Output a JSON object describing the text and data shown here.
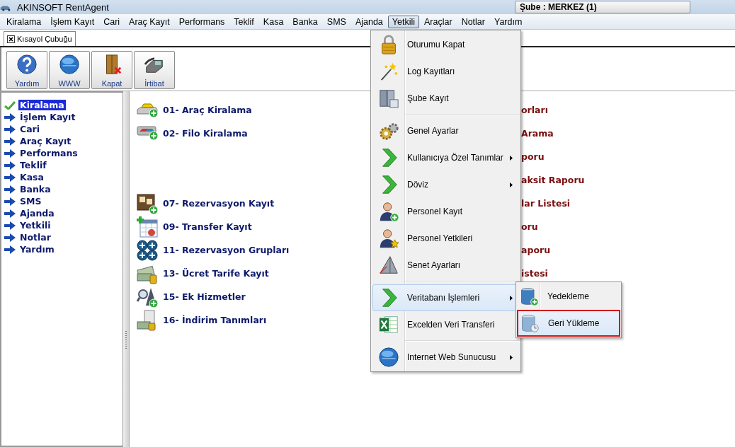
{
  "window": {
    "title": "AKINSOFT RentAgent",
    "branch": "Şube : MERKEZ (1)"
  },
  "menubar": [
    {
      "label": "Kiralama",
      "selected": false
    },
    {
      "label": "İşlem Kayıt",
      "selected": false
    },
    {
      "label": "Cari",
      "selected": false
    },
    {
      "label": "Araç Kayıt",
      "selected": false
    },
    {
      "label": "Performans",
      "selected": false
    },
    {
      "label": "Teklif",
      "selected": false
    },
    {
      "label": "Kasa",
      "selected": false
    },
    {
      "label": "Banka",
      "selected": false
    },
    {
      "label": "SMS",
      "selected": false
    },
    {
      "label": "Ajanda",
      "selected": false
    },
    {
      "label": "Yetkili",
      "selected": true
    },
    {
      "label": "Araçlar",
      "selected": false
    },
    {
      "label": "Notlar",
      "selected": false
    },
    {
      "label": "Yardım",
      "selected": false
    }
  ],
  "tab": {
    "label": "Kısayol Çubuğu"
  },
  "toolbar": [
    "Yardım",
    "WWW",
    "Kapat",
    "İrtibat"
  ],
  "sidebar": [
    {
      "label": "Kiralama",
      "selected": true
    },
    {
      "label": "İşlem Kayıt",
      "selected": false
    },
    {
      "label": "Cari",
      "selected": false
    },
    {
      "label": "Araç Kayıt",
      "selected": false
    },
    {
      "label": "Performans",
      "selected": false
    },
    {
      "label": "Teklif",
      "selected": false
    },
    {
      "label": "Kasa",
      "selected": false
    },
    {
      "label": "Banka",
      "selected": false
    },
    {
      "label": "SMS",
      "selected": false
    },
    {
      "label": "Ajanda",
      "selected": false
    },
    {
      "label": "Yetkili",
      "selected": false
    },
    {
      "label": "Notlar",
      "selected": false
    },
    {
      "label": "Yardım",
      "selected": false
    }
  ],
  "shortcuts_left": [
    "01- Araç Kiralama",
    "02- Filo Kiralama",
    "07- Rezervasyon Kayıt",
    "09- Transfer Kayıt",
    "11- Rezervasyon Grupları",
    "13- Ücret Tarife Kayıt",
    "15- Ek Hizmetler",
    "16- İndirim Tanımları"
  ],
  "shortcuts_right": [
    "orları",
    "Arama",
    "poru",
    "aksit Raporu",
    "lar Listesi",
    "oru",
    "aporu",
    "istesi"
  ],
  "menu": [
    {
      "kind": "item",
      "label": "Oturumu Kapat",
      "submenu": false,
      "selected": false
    },
    {
      "kind": "item",
      "label": "Log Kayıtları",
      "submenu": false,
      "selected": false
    },
    {
      "kind": "item",
      "label": "Şube Kayıt",
      "submenu": false,
      "selected": false
    },
    {
      "kind": "separator"
    },
    {
      "kind": "item",
      "label": "Genel Ayarlar",
      "submenu": false,
      "selected": false
    },
    {
      "kind": "item",
      "label": "Kullanıcıya Özel Tanımlar",
      "submenu": true,
      "selected": false
    },
    {
      "kind": "item",
      "label": "Döviz",
      "submenu": true,
      "selected": false
    },
    {
      "kind": "item",
      "label": "Personel Kayıt",
      "submenu": false,
      "selected": false
    },
    {
      "kind": "item",
      "label": "Personel Yetkileri",
      "submenu": false,
      "selected": false
    },
    {
      "kind": "item",
      "label": "Senet Ayarları",
      "submenu": false,
      "selected": false
    },
    {
      "kind": "separator"
    },
    {
      "kind": "item",
      "label": "Veritabanı İşlemleri",
      "submenu": true,
      "selected": true
    },
    {
      "kind": "item",
      "label": "Excelden Veri Transferi",
      "submenu": false,
      "selected": false
    },
    {
      "kind": "separator"
    },
    {
      "kind": "item",
      "label": "Internet Web Sunucusu",
      "submenu": true,
      "selected": false
    }
  ],
  "submenu": [
    {
      "label": "Yedekleme",
      "selected": false
    },
    {
      "label": "Geri Yükleme",
      "selected": true
    }
  ]
}
